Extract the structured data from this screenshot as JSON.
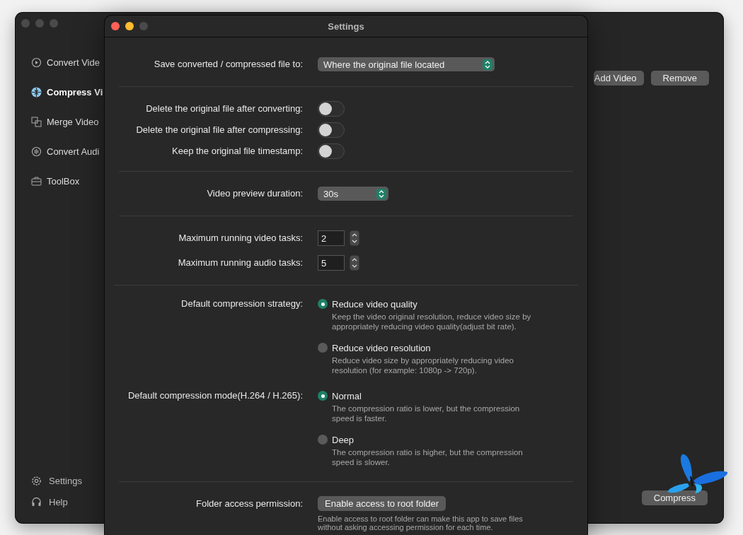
{
  "main_window": {
    "sidebar": {
      "items": [
        {
          "label": "Convert Vide",
          "selected": false
        },
        {
          "label": "Compress Vi",
          "selected": true
        },
        {
          "label": "Merge Video",
          "selected": false
        },
        {
          "label": "Convert Audi",
          "selected": false
        },
        {
          "label": "ToolBox",
          "selected": false
        }
      ],
      "footer_items": [
        {
          "label": "Settings"
        },
        {
          "label": "Help"
        }
      ]
    },
    "toolbar_buttons": [
      "Add Video",
      "Remove"
    ],
    "action_button": "Compress"
  },
  "settings_dialog": {
    "title": "Settings",
    "sections": [
      {
        "kind": "select",
        "rows": [
          {
            "label": "Save converted / compressed file to:",
            "value": "Where the original file located"
          }
        ]
      },
      {
        "kind": "toggle",
        "rows": [
          {
            "label": "Delete the original file after converting:",
            "on": false
          },
          {
            "label": "Delete the original file after compressing:",
            "on": false
          },
          {
            "label": "Keep the original file timestamp:",
            "on": false
          }
        ]
      },
      {
        "kind": "select",
        "rows": [
          {
            "label": "Video preview duration:",
            "value": "30s"
          }
        ]
      },
      {
        "kind": "stepper",
        "rows": [
          {
            "label": "Maximum running video tasks:",
            "value": "2"
          },
          {
            "label": "Maximum running audio tasks:",
            "value": "5"
          }
        ]
      },
      {
        "kind": "radio",
        "rows": [
          {
            "label": "Default compression strategy:",
            "options": [
              {
                "label": "Reduce video quality",
                "description": "Keep the video original resolution, reduce video size by appropriately reducing video quality(adjust bit rate).",
                "selected": true
              },
              {
                "label": "Reduce video resolution",
                "description": "Reduce video size by appropriately reducing video resolution (for example: 1080p -> 720p).",
                "selected": false
              }
            ]
          },
          {
            "label": "Default compression mode(H.264 / H.265):",
            "options": [
              {
                "label": "Normal",
                "description": "The compression ratio is lower, but the compression speed is faster.",
                "selected": true
              },
              {
                "label": "Deep",
                "description": "The compression ratio is higher, but the compression speed is slower.",
                "selected": false
              }
            ]
          }
        ]
      },
      {
        "kind": "button",
        "rows": [
          {
            "label": "Folder access permission:",
            "button": "Enable access to root folder",
            "description": "Enable access to root folder can make this app to save files without asking accessing permission for each time."
          }
        ]
      }
    ]
  }
}
